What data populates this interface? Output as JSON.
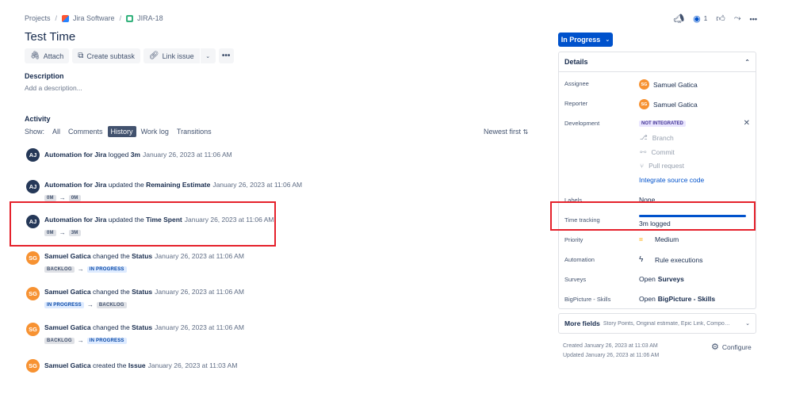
{
  "breadcrumb": {
    "projects": "Projects",
    "project": "Jira Software",
    "issue_key": "JIRA-18"
  },
  "issue": {
    "title": "Test Time"
  },
  "toolbar": {
    "attach": "Attach",
    "create_subtask": "Create subtask",
    "link_issue": "Link issue"
  },
  "description": {
    "label": "Description",
    "placeholder": "Add a description..."
  },
  "activity": {
    "label": "Activity",
    "show_label": "Show:",
    "filters": [
      "All",
      "Comments",
      "History",
      "Work log",
      "Transitions"
    ],
    "active_filter": "History",
    "sort_label": "Newest first",
    "entries": [
      {
        "initials": "AJ",
        "actor": "Automation for Jira",
        "action": "logged",
        "field": "3m",
        "time": "January 26, 2023 at 11:06 AM"
      },
      {
        "initials": "AJ",
        "actor": "Automation for Jira",
        "action": "updated the",
        "field": "Remaining Estimate",
        "time": "January 26, 2023 at 11:06 AM",
        "from": "0m",
        "to": "0m"
      },
      {
        "initials": "AJ",
        "actor": "Automation for Jira",
        "action": "updated the",
        "field": "Time Spent",
        "time": "January 26, 2023 at 11:06 AM",
        "from": "0m",
        "to": "3m"
      },
      {
        "initials": "SG",
        "actor": "Samuel Gatica",
        "action": "changed the",
        "field": "Status",
        "time": "January 26, 2023 at 11:06 AM",
        "from": "BACKLOG",
        "to": "IN PROGRESS"
      },
      {
        "initials": "SG",
        "actor": "Samuel Gatica",
        "action": "changed the",
        "field": "Status",
        "time": "January 26, 2023 at 11:06 AM",
        "from": "IN PROGRESS",
        "to": "BACKLOG"
      },
      {
        "initials": "SG",
        "actor": "Samuel Gatica",
        "action": "changed the",
        "field": "Status",
        "time": "January 26, 2023 at 11:06 AM",
        "from": "BACKLOG",
        "to": "IN PROGRESS"
      },
      {
        "initials": "SG",
        "actor": "Samuel Gatica",
        "action": "created the",
        "field": "Issue",
        "time": "January 26, 2023 at 11:03 AM"
      }
    ]
  },
  "header_actions": {
    "watchers": "1"
  },
  "status": {
    "label": "In Progress"
  },
  "details": {
    "heading": "Details",
    "assignee_label": "Assignee",
    "assignee": "Samuel Gatica",
    "assignee_initials": "SG",
    "reporter_label": "Reporter",
    "reporter": "Samuel Gatica",
    "reporter_initials": "SG",
    "development_label": "Development",
    "development_status": "NOT INTEGRATED",
    "dev_branch": "Branch",
    "dev_commit": "Commit",
    "dev_pull_request": "Pull request",
    "integrate_link": "Integrate source code",
    "labels_label": "Labels",
    "labels_value": "None",
    "time_tracking_label": "Time tracking",
    "time_logged": "3m logged",
    "time_progress": 1.0,
    "priority_label": "Priority",
    "priority": "Medium",
    "automation_label": "Automation",
    "automation": "Rule executions",
    "surveys_label": "Surveys",
    "surveys_prefix": "Open",
    "surveys_name": "Surveys",
    "bigpicture_label": "BigPicture - Skills",
    "bigpicture_prefix": "Open",
    "bigpicture_name": "BigPicture - Skills"
  },
  "more_fields": {
    "title": "More fields",
    "summary": "Story Points, Original estimate, Epic Link, Components, F..."
  },
  "meta": {
    "created": "Created January 26, 2023 at 11:03 AM",
    "updated": "Updated January 26, 2023 at 11:06 AM",
    "configure": "Configure"
  },
  "colors": {
    "accent": "#0052cc",
    "highlight": "#e5212b",
    "avatar_aj": "#253858",
    "avatar_sg": "#f79232"
  }
}
